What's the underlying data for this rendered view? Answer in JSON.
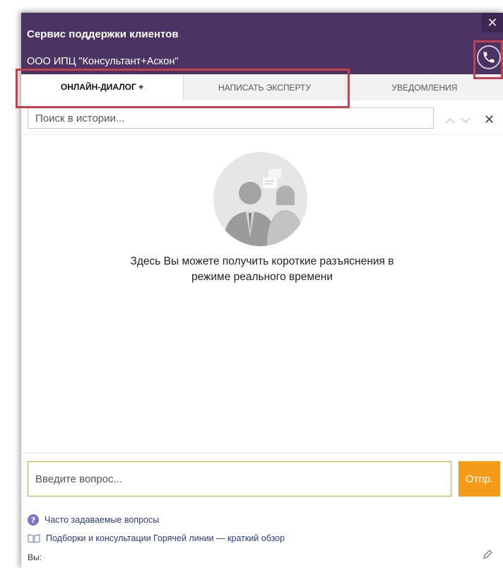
{
  "header": {
    "title": "Сервис поддержки клиентов",
    "subtitle": "ООО ИПЦ \"Консультант+Аскон\"",
    "close_glyph": "✕"
  },
  "tabs": [
    {
      "label": "ОНЛАЙН-ДИАЛОГ +",
      "active": true
    },
    {
      "label": "НАПИСАТЬ ЭКСПЕРТУ",
      "active": false
    },
    {
      "label": "УВЕДОМЛЕНИЯ",
      "active": false
    }
  ],
  "search": {
    "placeholder": "Поиск в истории...",
    "close_glyph": "✕"
  },
  "empty_state": {
    "hint": "Здесь Вы можете получить короткие разъяснения в режиме реального времени"
  },
  "composer": {
    "placeholder": "Введите вопрос...",
    "send_label": "Отпр."
  },
  "links": [
    {
      "label": "Часто задаваемые вопросы",
      "icon": "help-icon"
    },
    {
      "label": "Подборки и консультации Горячей линии — краткий обзор",
      "icon": "book-icon"
    }
  ],
  "footer": {
    "you_label": "Вы:"
  },
  "colors": {
    "header_bg": "#4b3463",
    "accent_orange": "#f59b18",
    "highlight_red": "#c8404d"
  }
}
